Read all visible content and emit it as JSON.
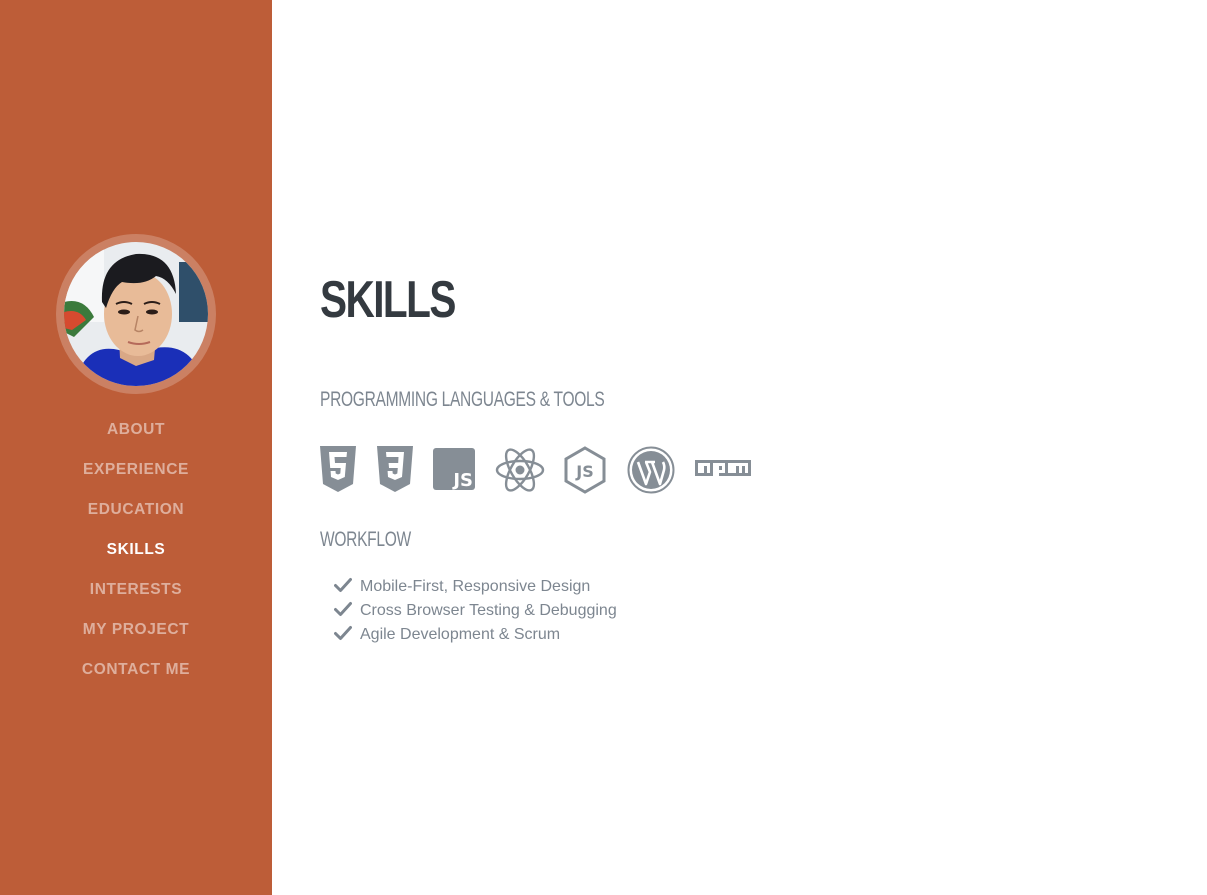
{
  "nav": {
    "items": [
      {
        "label": "About",
        "active": false
      },
      {
        "label": "Experience",
        "active": false
      },
      {
        "label": "Education",
        "active": false
      },
      {
        "label": "Skills",
        "active": true
      },
      {
        "label": "Interests",
        "active": false
      },
      {
        "label": "My Project",
        "active": false
      },
      {
        "label": "Contact Me",
        "active": false
      }
    ]
  },
  "main": {
    "title": "Skills",
    "tools_heading": "Programming Languages & Tools",
    "tools_icons": [
      "html5-icon",
      "css3-icon",
      "javascript-icon",
      "react-icon",
      "nodejs-icon",
      "wordpress-icon",
      "npm-icon"
    ],
    "workflow_heading": "Workflow",
    "workflow_items": [
      "Mobile-First, Responsive Design",
      "Cross Browser Testing & Debugging",
      "Agile Development & Scrum"
    ]
  },
  "colors": {
    "sidebar": "#bd5d38",
    "title": "#343a40",
    "muted": "#7d8690",
    "icon": "#868e96"
  }
}
